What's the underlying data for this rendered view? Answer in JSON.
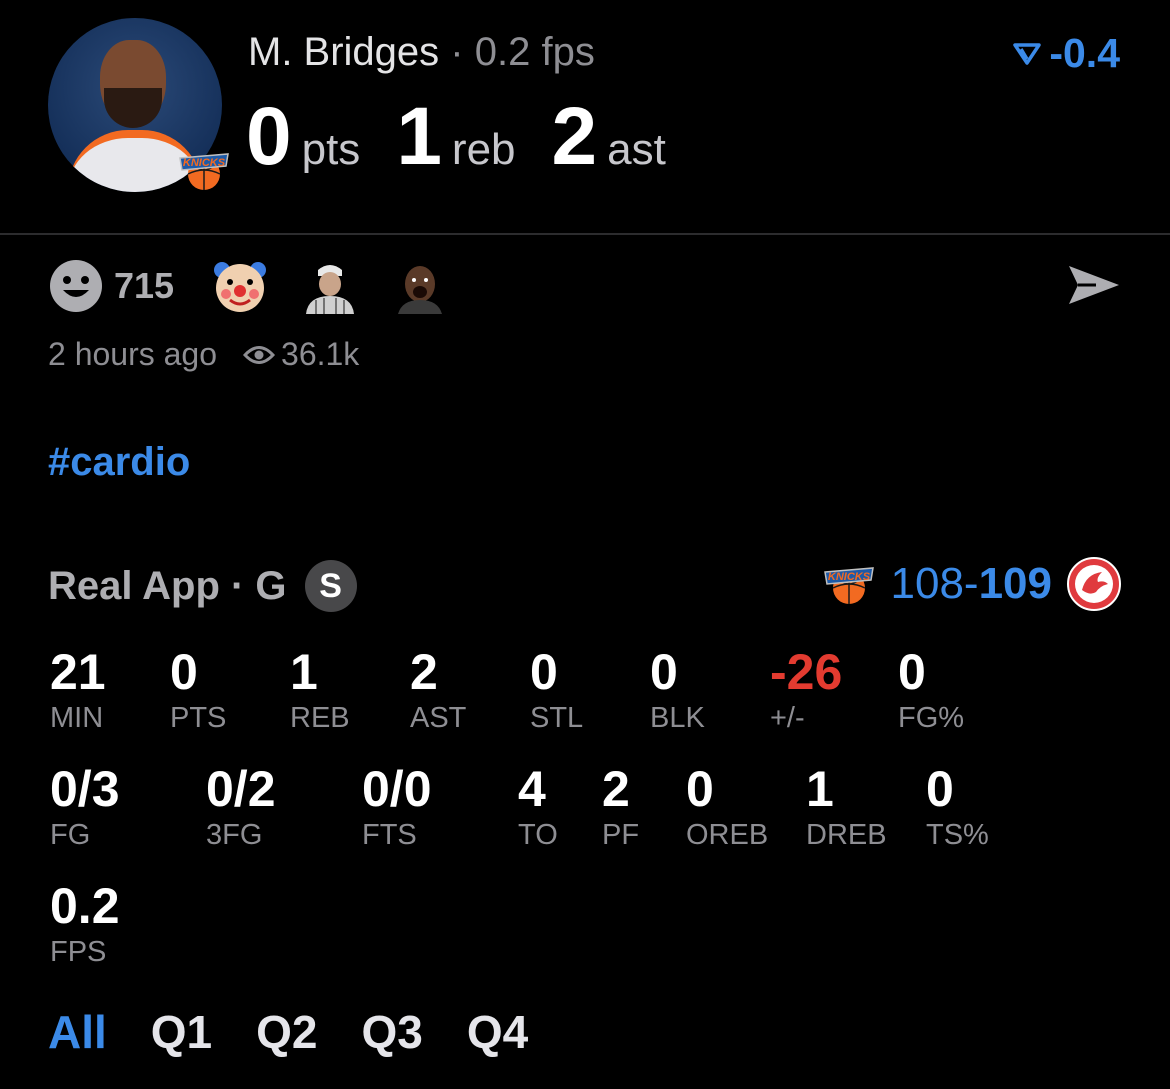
{
  "player": {
    "name": "M. Bridges",
    "separator": "·",
    "fps": "0.2 fps",
    "trend": "-0.4",
    "pts": "0",
    "pts_unit": "pts",
    "reb": "1",
    "reb_unit": "reb",
    "ast": "2",
    "ast_unit": "ast"
  },
  "reactions": {
    "count": "715",
    "emojis": [
      "clown",
      "person-avatar",
      "player-avatar"
    ]
  },
  "meta": {
    "time_ago": "2 hours ago",
    "views": "36.1k"
  },
  "hashtag": "#cardio",
  "game": {
    "source": "Real App · G",
    "badge": "S",
    "home_score": "108",
    "dash": "-",
    "away_score": "109"
  },
  "stats_row1": [
    {
      "value": "21",
      "label": "MIN",
      "negative": false
    },
    {
      "value": "0",
      "label": "PTS",
      "negative": false
    },
    {
      "value": "1",
      "label": "REB",
      "negative": false
    },
    {
      "value": "2",
      "label": "AST",
      "negative": false
    },
    {
      "value": "0",
      "label": "STL",
      "negative": false
    },
    {
      "value": "0",
      "label": "BLK",
      "negative": false
    },
    {
      "value": "-26",
      "label": "+/-",
      "negative": true
    },
    {
      "value": "0",
      "label": "FG%",
      "negative": false
    }
  ],
  "stats_row2": [
    {
      "value": "0/3",
      "label": "FG"
    },
    {
      "value": "0/2",
      "label": "3FG"
    },
    {
      "value": "0/0",
      "label": "FTS"
    },
    {
      "value": "4",
      "label": "TO"
    },
    {
      "value": "2",
      "label": "PF"
    },
    {
      "value": "0",
      "label": "OREB"
    },
    {
      "value": "1",
      "label": "DREB"
    },
    {
      "value": "0",
      "label": "TS%"
    }
  ],
  "stats_row3": [
    {
      "value": "0.2",
      "label": "FPS"
    }
  ],
  "quarters": [
    "All",
    "Q1",
    "Q2",
    "Q3",
    "Q4"
  ],
  "active_quarter": "All",
  "colors": {
    "accent": "#3b8ae8",
    "negative": "#e33b30",
    "knicks_orange": "#f26a21",
    "knicks_blue": "#1d5aa8",
    "hawks_red": "#e03a3e"
  }
}
